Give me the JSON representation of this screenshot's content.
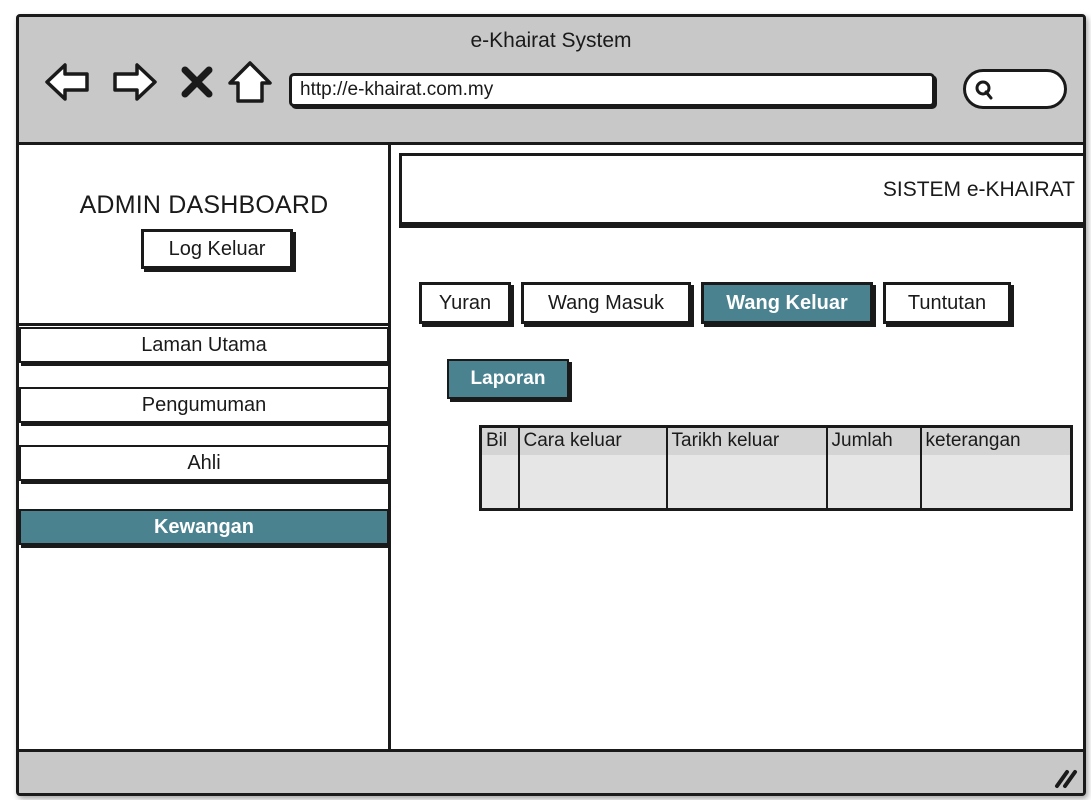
{
  "window": {
    "title": "e-Khairat System"
  },
  "toolbar": {
    "back_icon": "back-arrow-icon",
    "forward_icon": "forward-arrow-icon",
    "stop_icon": "close-icon",
    "home_icon": "home-icon",
    "url": "http://e-khairat.com.my",
    "search_icon": "search-icon"
  },
  "sidebar": {
    "title": "ADMIN DASHBOARD",
    "logout_label": "Log Keluar",
    "items": [
      {
        "label": "Laman Utama",
        "active": false
      },
      {
        "label": "Pengumuman",
        "active": false
      },
      {
        "label": "Ahli",
        "active": false
      },
      {
        "label": "Kewangan",
        "active": true
      }
    ]
  },
  "header": {
    "system_title": "SISTEM e-KHAIRAT"
  },
  "tabs": [
    {
      "label": "Yuran",
      "active": false
    },
    {
      "label": "Wang Masuk",
      "active": false
    },
    {
      "label": "Wang Keluar",
      "active": true
    },
    {
      "label": "Tuntutan",
      "active": false
    }
  ],
  "report_button": "Laporan",
  "table": {
    "columns": [
      "Bil",
      "Cara keluar",
      "Tarikh keluar",
      "Jumlah",
      "keterangan"
    ],
    "rows": []
  },
  "colors": {
    "accent": "#4a8290",
    "chrome": "#c8c8c8"
  }
}
